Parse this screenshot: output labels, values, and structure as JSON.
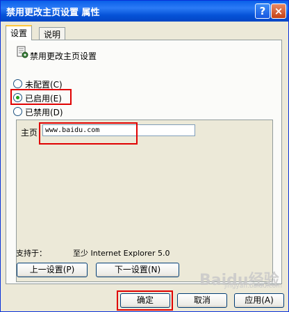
{
  "window": {
    "title": "禁用更改主页设置 属性",
    "help_label": "?",
    "close_label": "×"
  },
  "tabs": [
    {
      "label": "设置",
      "active": true
    },
    {
      "label": "说明",
      "active": false
    }
  ],
  "setting": {
    "name": "禁用更改主页设置"
  },
  "options": [
    {
      "label": "未配置(C)",
      "checked": false
    },
    {
      "label": "已启用(E)",
      "checked": true
    },
    {
      "label": "已禁用(D)",
      "checked": false
    }
  ],
  "homepage": {
    "label": "主页",
    "value": "www.baidu.com"
  },
  "support": {
    "label": "支持于：",
    "value": "至少 Internet Explorer 5.0"
  },
  "nav_buttons": {
    "prev": "上一设置(P)",
    "next": "下一设置(N)"
  },
  "dialog_buttons": {
    "ok": "确定",
    "cancel": "取消",
    "apply": "应用(A)"
  },
  "watermark": {
    "logo": "Baidu经验",
    "sub": "jingyan.baidu.com"
  },
  "colors": {
    "highlight": "#E00000",
    "title_bar": "#0A5FE8",
    "dialog_bg": "#ECE9D8"
  }
}
